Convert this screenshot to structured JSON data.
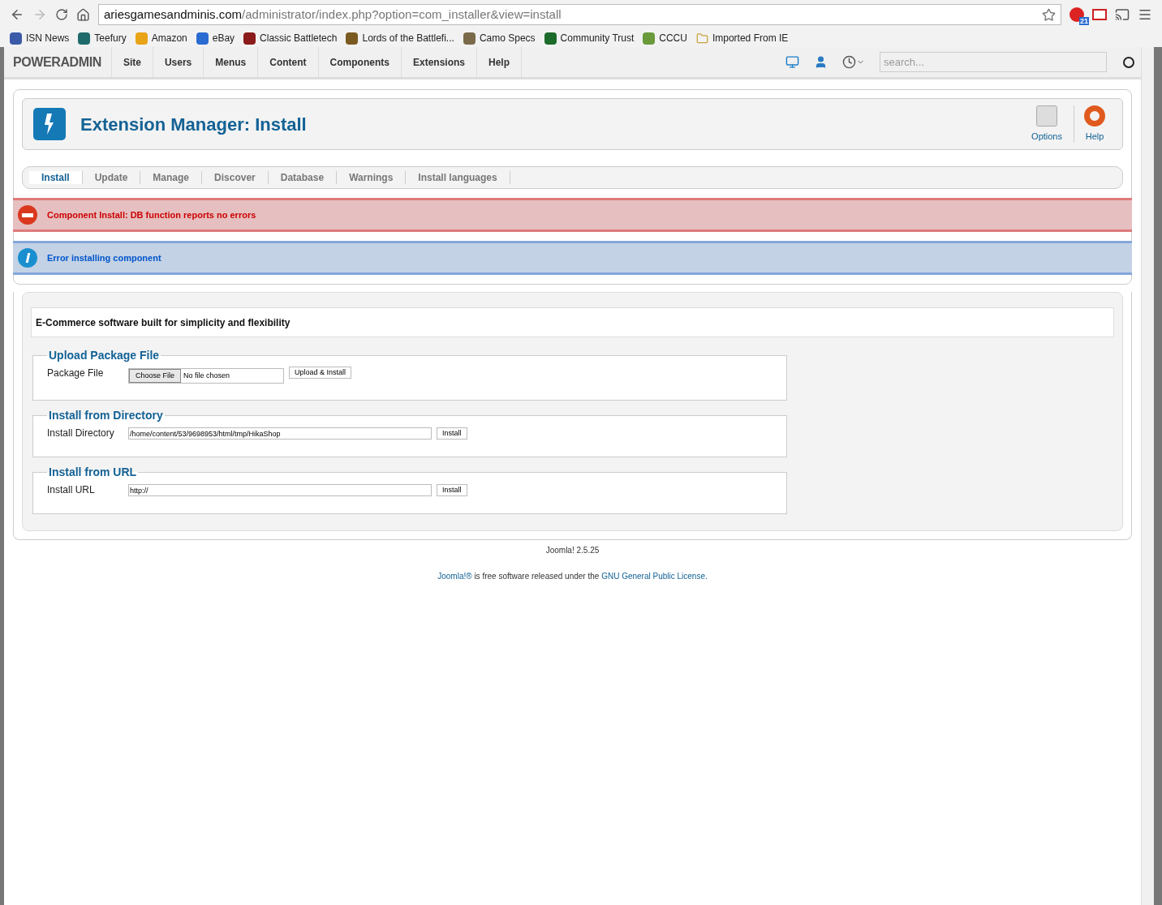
{
  "browser": {
    "url_host": "ariesgamesandminis.com",
    "url_path": "/administrator/index.php?option=com_installer&view=install",
    "extension_badge": "21"
  },
  "bookmarks": [
    "ISN News",
    "Teefury",
    "Amazon",
    "eBay",
    "Classic Battletech",
    "Lords of the Battlefi...",
    "Camo Specs",
    "Community Trust",
    "CCCU",
    "Imported From IE"
  ],
  "admin_bar": {
    "logo": "POWERADMIN",
    "menu": [
      "Site",
      "Users",
      "Menus",
      "Content",
      "Components",
      "Extensions",
      "Help"
    ],
    "search": {
      "placeholder": "search..."
    }
  },
  "header": {
    "title": "Extension Manager: Install",
    "toolbar": [
      "Options",
      "Help"
    ]
  },
  "tabs": [
    {
      "label": "Install",
      "selected": true
    },
    {
      "label": "Update",
      "selected": false
    },
    {
      "label": "Manage",
      "selected": false
    },
    {
      "label": "Discover",
      "selected": false
    },
    {
      "label": "Database",
      "selected": false
    },
    {
      "label": "Warnings",
      "selected": false
    },
    {
      "label": "Install languages",
      "selected": false
    }
  ],
  "messages": [
    {
      "kind": "error",
      "text": "Component Install: DB function reports no errors"
    },
    {
      "kind": "info",
      "text": "Error installing component"
    }
  ],
  "description": "E-Commerce software built for simplicity and flexibility",
  "sections": [
    {
      "kind": "file",
      "legend": "Upload Package File",
      "label": "Package File",
      "choose": "Choose File",
      "file_status": "No file chosen",
      "button": "Upload & Install"
    },
    {
      "kind": "text",
      "legend": "Install from Directory",
      "label": "Install Directory",
      "value": "/home/content/53/9698953/html/tmp/HikaShop",
      "button": "Install"
    },
    {
      "kind": "text",
      "legend": "Install from URL",
      "label": "Install URL",
      "value": "http://",
      "button": "Install"
    }
  ],
  "footer": {
    "version": "Joomla! 2.5.25",
    "license_prefix": "Joomla!®",
    "license_middle": "is free software released under the",
    "license_link": "GNU General Public License."
  }
}
